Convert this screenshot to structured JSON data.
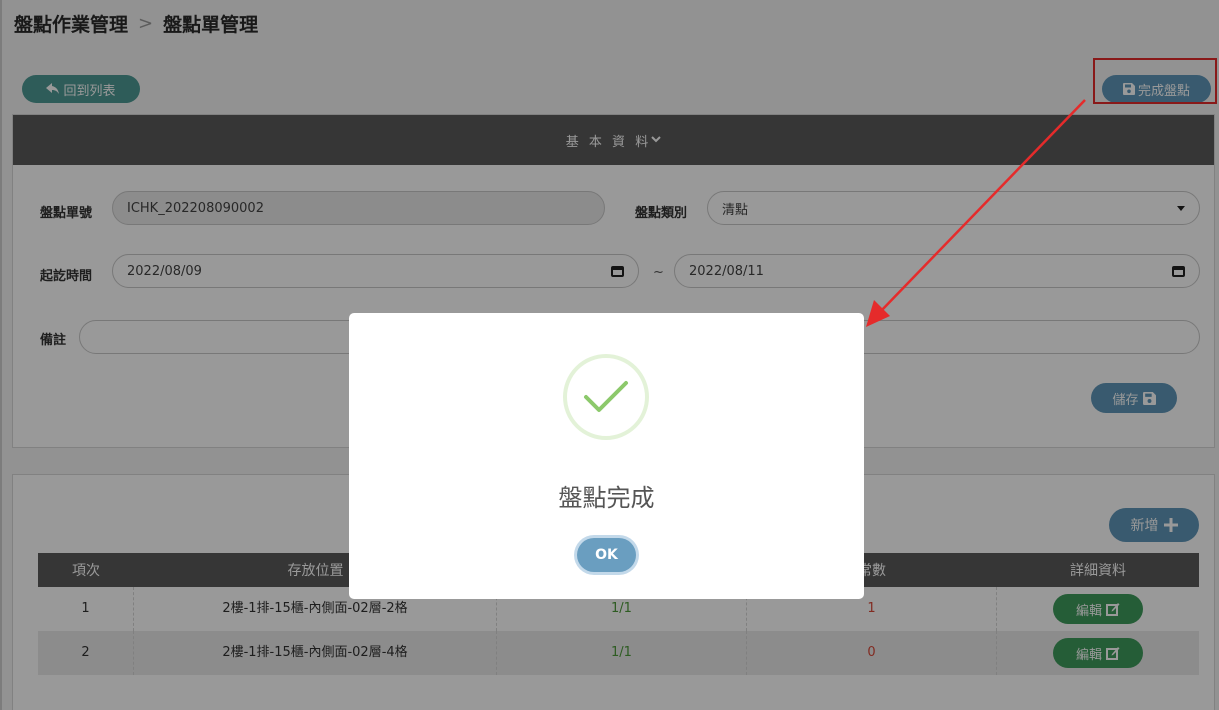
{
  "breadcrumb": {
    "parent": "盤點作業管理",
    "separator": ">",
    "current": "盤點單管理"
  },
  "toolbar": {
    "back_label": "回到列表",
    "finish_label": "完成盤點"
  },
  "basic_info": {
    "header": "基 本 資 料",
    "order_no_label": "盤點單號",
    "order_no_value": "ICHK_202208090002",
    "type_label": "盤點類別",
    "type_value": "清點",
    "period_label": "起訖時間",
    "start_date": "2022/08/09",
    "tilde": "~",
    "end_date": "2022/08/11",
    "remark_label": "備註",
    "remark_value": "",
    "save_label": "儲存"
  },
  "detail": {
    "add_label": "新增",
    "columns": [
      "項次",
      "存放位置",
      "",
      "常數",
      "詳細資料"
    ],
    "rows": [
      {
        "index": "1",
        "location": "2樓-1排-15櫃-內側面-02層-2格",
        "count": "1/1",
        "abnormal": "1",
        "edit_label": "編輯"
      },
      {
        "index": "2",
        "location": "2樓-1排-15櫃-內側面-02層-4格",
        "count": "1/1",
        "abnormal": "0",
        "edit_label": "編輯"
      }
    ]
  },
  "modal": {
    "title": "盤點完成",
    "ok_label": "OK"
  },
  "colors": {
    "primary": "#5f97b9",
    "back": "#4d9a94",
    "edit": "#3e9b5c",
    "highlight": "#e52b2b",
    "success": "#8cc96b"
  }
}
